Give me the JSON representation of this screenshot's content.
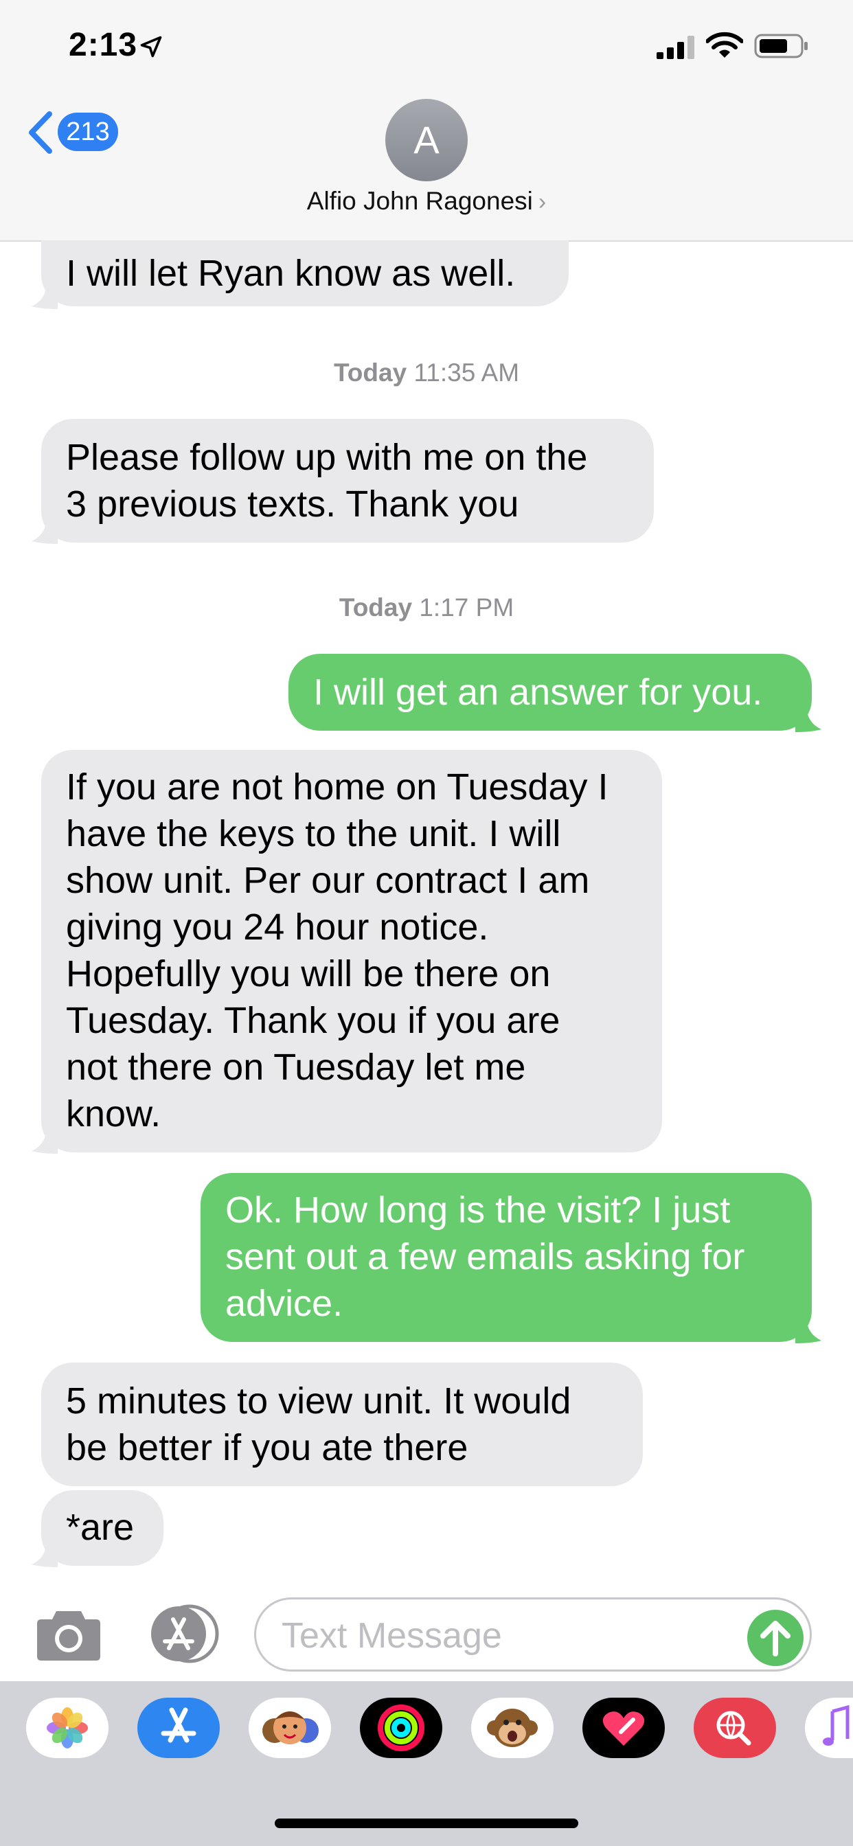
{
  "status_bar": {
    "time": "2:13"
  },
  "header": {
    "back_count": "213",
    "avatar_initial": "A",
    "contact_name": "Alfio John Ragonesi",
    "contact_chevron": "›"
  },
  "messages": [
    {
      "direction": "incoming",
      "lines": [
        "I will let Ryan know as well."
      ]
    },
    {
      "type": "timestamp",
      "day": "Today",
      "time": "11:35 AM"
    },
    {
      "direction": "incoming",
      "lines": [
        "Please follow up with me on the",
        "3 previous texts. Thank you"
      ]
    },
    {
      "type": "timestamp",
      "day": "Today",
      "time": "1:17 PM"
    },
    {
      "direction": "outgoing",
      "lines": [
        "I will get an answer for you."
      ]
    },
    {
      "direction": "incoming",
      "lines": [
        "If you are not home on Tuesday I",
        "have the keys to the unit. I will",
        "show unit. Per our contract I am",
        "giving you 24 hour notice.",
        "Hopefully you will be there on",
        "Tuesday. Thank you if you are",
        "not there on Tuesday let me",
        "know."
      ]
    },
    {
      "direction": "outgoing",
      "lines": [
        "Ok. How long is the visit? I just",
        "sent out a few emails asking for",
        "advice."
      ]
    },
    {
      "direction": "incoming",
      "lines": [
        "5 minutes to view unit. It would",
        "be better if you ate there"
      ]
    },
    {
      "direction": "incoming",
      "lines": [
        "*are"
      ]
    }
  ],
  "input": {
    "placeholder": "Text Message"
  },
  "icons": {
    "location": "location-arrow-icon",
    "signal": "cellular-signal-icon",
    "wifi": "wifi-icon",
    "battery": "battery-icon",
    "camera": "camera-icon",
    "apps": "app-store-icon",
    "send": "send-arrow-icon"
  },
  "app_drawer": [
    "photos",
    "app-store",
    "memoji",
    "activity",
    "animoji",
    "heart-digital-touch",
    "web-search",
    "music"
  ],
  "colors": {
    "incoming_bubble": "#e9e9eb",
    "outgoing_bubble": "#67cc6e",
    "accent_blue": "#2f80f2",
    "send_green": "#5cc165"
  }
}
